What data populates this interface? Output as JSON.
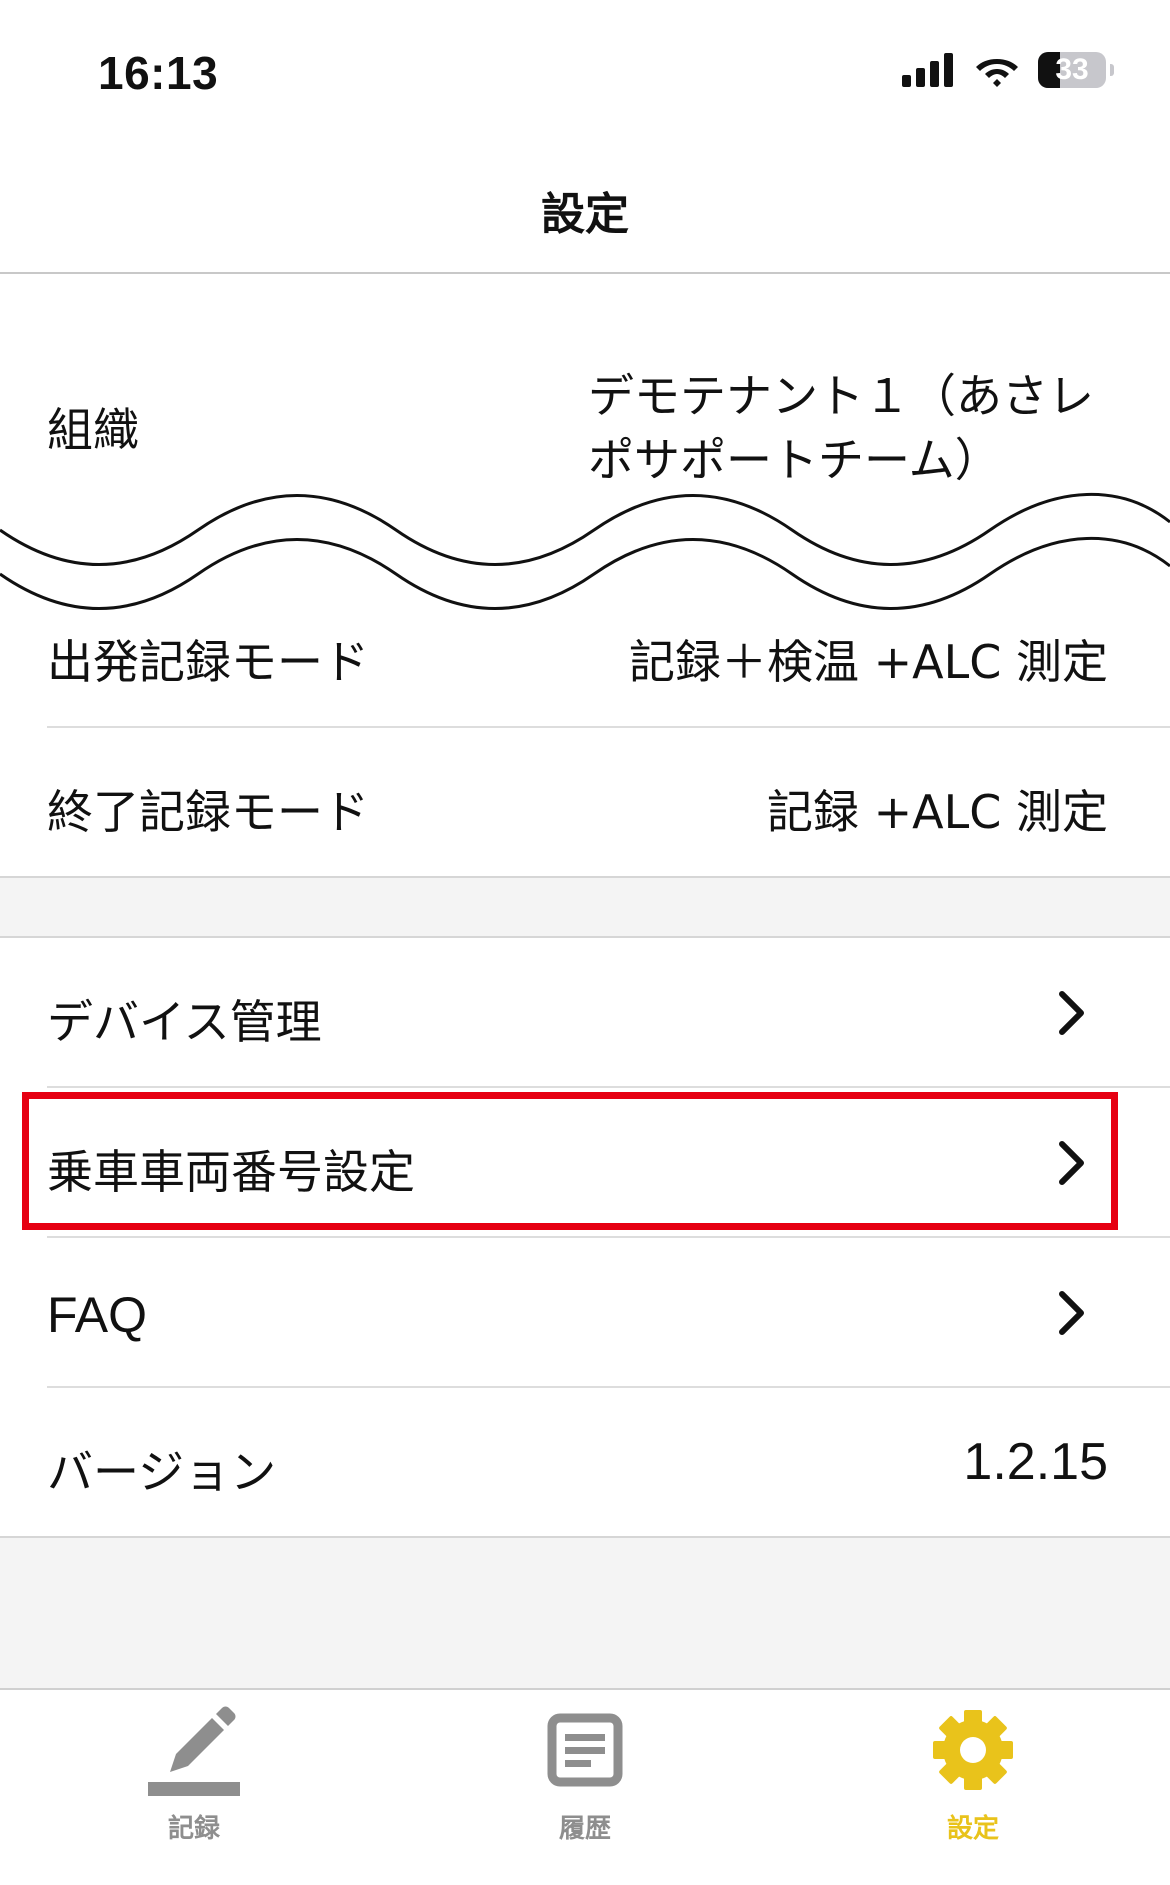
{
  "status_bar": {
    "time": "16:13",
    "battery": "33",
    "battery_level_percent": 33,
    "icons": [
      "cellular-signal-icon",
      "wifi-icon",
      "battery-icon"
    ]
  },
  "header": {
    "title": "設定"
  },
  "settings": {
    "organization": {
      "label": "組織",
      "value": "デモテナント１（あさレポサポートチーム）"
    },
    "departure_mode": {
      "label": "出発記録モード",
      "value": "記録＋検温 +ALC 測定"
    },
    "end_mode": {
      "label": "終了記録モード",
      "value": "記録 +ALC 測定"
    }
  },
  "menu": {
    "device_management": "デバイス管理",
    "vehicle_number": "乗車車両番号設定",
    "faq": "FAQ",
    "version_label": "バージョン",
    "version_value": "1.2.15"
  },
  "tabbar": {
    "tabs": [
      {
        "label": "記録",
        "icon": "pencil-icon",
        "active": false
      },
      {
        "label": "履歴",
        "icon": "document-icon",
        "active": false
      },
      {
        "label": "設定",
        "icon": "gear-icon",
        "active": true
      }
    ]
  },
  "colors": {
    "accent": "#e9c31b",
    "highlight_border": "#e60012",
    "inactive_tab": "#8e8e8e",
    "section_background": "#f4f4f4"
  }
}
